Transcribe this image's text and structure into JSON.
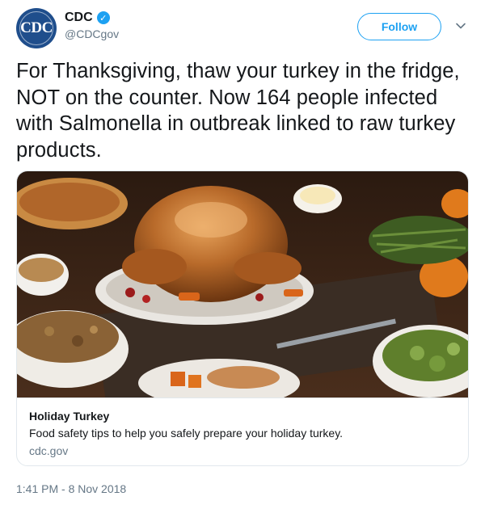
{
  "account": {
    "display_name": "CDC",
    "handle": "@CDCgov",
    "avatar_text": "CDC",
    "verified_icon": "verified-check-icon"
  },
  "follow_label": "Follow",
  "tweet_text": "For Thanksgiving, thaw your turkey in the fridge, NOT on the counter. Now 164 people infected with Salmonella in outbreak linked to raw turkey products.",
  "card": {
    "title": "Holiday Turkey",
    "description": "Food safety tips to help you safely prepare your holiday turkey.",
    "domain": "cdc.gov",
    "image_subject": "roast turkey holiday dinner"
  },
  "timestamp": "1:41 PM - 8 Nov 2018",
  "colors": {
    "accent": "#1da1f2",
    "text": "#14171a",
    "secondary": "#657786",
    "avatar_bg": "#1f4e8c"
  }
}
